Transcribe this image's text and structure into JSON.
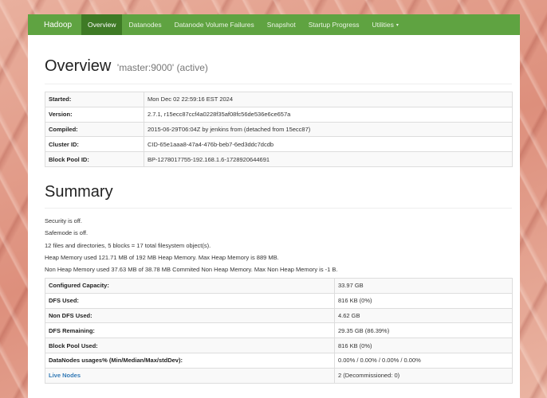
{
  "navbar": {
    "brand": "Hadoop",
    "items": [
      {
        "label": "Overview",
        "active": true
      },
      {
        "label": "Datanodes"
      },
      {
        "label": "Datanode Volume Failures"
      },
      {
        "label": "Snapshot"
      },
      {
        "label": "Startup Progress"
      },
      {
        "label": "Utilities"
      }
    ],
    "utilities_caret": "▾"
  },
  "overview": {
    "title": "Overview",
    "subtitle": "'master:9000' (active)",
    "rows": [
      {
        "key": "Started:",
        "value": "Mon Dec 02 22:59:16 EST 2024"
      },
      {
        "key": "Version:",
        "value": "2.7.1, r15ecc87ccf4a0228f35af08fc56de536e6ce657a"
      },
      {
        "key": "Compiled:",
        "value": "2015-06-29T06:04Z by jenkins from (detached from 15ecc87)"
      },
      {
        "key": "Cluster ID:",
        "value": "CID-65e1aaa8-47a4-476b-beb7-6ed3ddc7dcdb"
      },
      {
        "key": "Block Pool ID:",
        "value": "BP-1278017755-192.168.1.6-1728920644691"
      }
    ]
  },
  "summary": {
    "title": "Summary",
    "lines": [
      "Security is off.",
      "Safemode is off.",
      "12 files and directories, 5 blocks = 17 total filesystem object(s).",
      "Heap Memory used 121.71 MB of 192 MB Heap Memory. Max Heap Memory is 889 MB.",
      "Non Heap Memory used 37.63 MB of 38.78 MB Commited Non Heap Memory. Max Non Heap Memory is -1 B."
    ],
    "rows": [
      {
        "key": "Configured Capacity:",
        "value": "33.97 GB"
      },
      {
        "key": "DFS Used:",
        "value": "816 KB (0%)"
      },
      {
        "key": "Non DFS Used:",
        "value": "4.62 GB"
      },
      {
        "key": "DFS Remaining:",
        "value": "29.35 GB (86.39%)"
      },
      {
        "key": "Block Pool Used:",
        "value": "816 KB (0%)"
      },
      {
        "key": "DataNodes usages% (Min/Median/Max/stdDev):",
        "value": "0.00% / 0.00% / 0.00% / 0.00%"
      },
      {
        "key": "Live Nodes",
        "value": "2 (Decommissioned: 0)"
      }
    ]
  }
}
